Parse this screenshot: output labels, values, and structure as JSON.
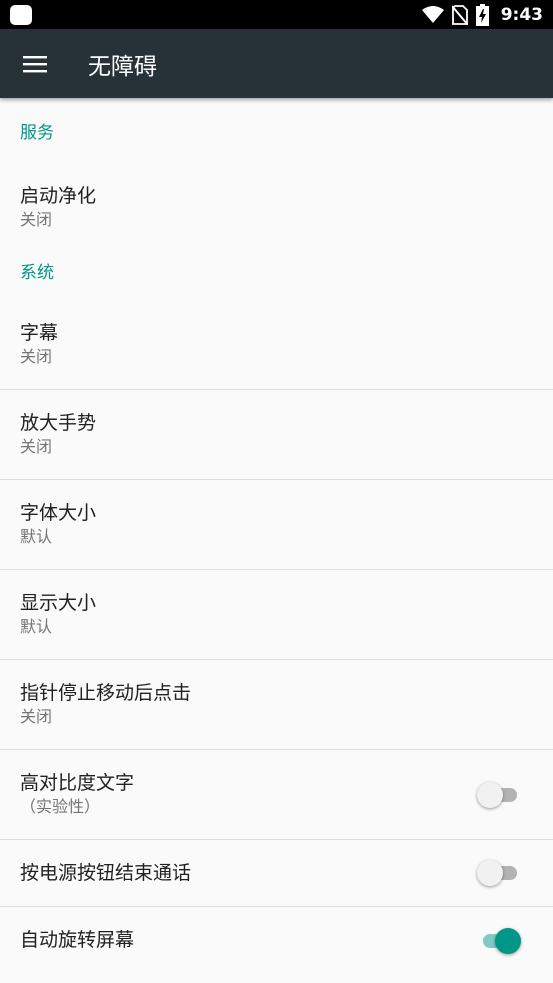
{
  "status_bar": {
    "time": "9:43",
    "icons": [
      "notification-icon",
      "wifi-icon",
      "no-sim-icon",
      "battery-charging-icon"
    ]
  },
  "app_bar": {
    "title": "无障碍",
    "menu_icon": "hamburger-menu-icon"
  },
  "sections": {
    "services": {
      "header": "服务",
      "items": [
        {
          "title": "启动净化",
          "summary": "关闭"
        }
      ]
    },
    "system": {
      "header": "系统",
      "items": [
        {
          "title": "字幕",
          "summary": "关闭"
        },
        {
          "title": "放大手势",
          "summary": "关闭"
        },
        {
          "title": "字体大小",
          "summary": "默认"
        },
        {
          "title": "显示大小",
          "summary": "默认"
        },
        {
          "title": "指针停止移动后点击",
          "summary": "关闭"
        },
        {
          "title": "高对比度文字",
          "summary": "（实验性）",
          "switch": false
        },
        {
          "title": "按电源按钮结束通话",
          "switch": false
        },
        {
          "title": "自动旋转屏幕",
          "switch": true
        }
      ]
    }
  },
  "colors": {
    "accent": "#009688",
    "app_bar": "#263238",
    "background": "#fafafa"
  }
}
